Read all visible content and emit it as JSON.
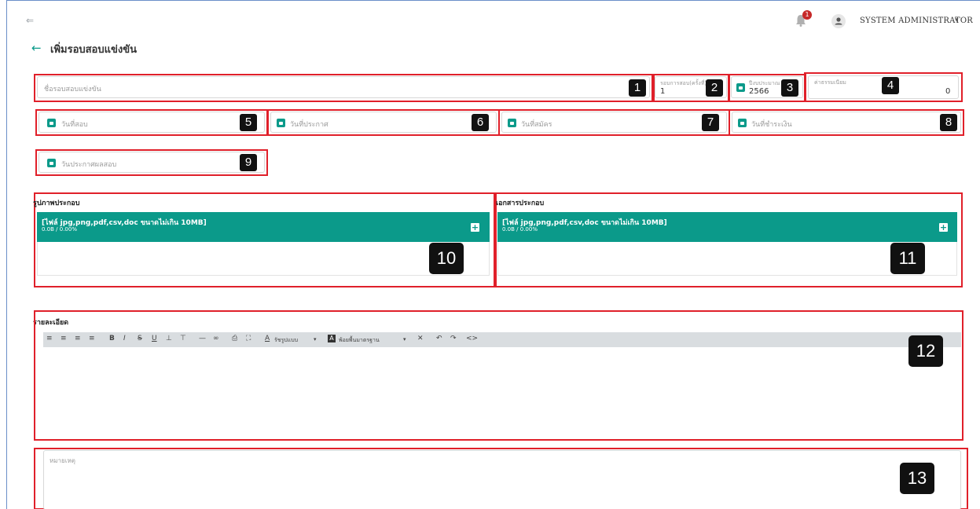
{
  "header": {
    "notification_count": "1",
    "user_name": "SYSTEM ADMINISTRATOR"
  },
  "page": {
    "title": "เพิ่มรอบสอบแข่งขัน"
  },
  "fields": {
    "round_name": {
      "placeholder": "ชื่อรอบสอบแข่งขัน",
      "marker": "1"
    },
    "round_no": {
      "label": "รอบการสอบ(ครั้งที่)",
      "value": "1",
      "marker": "2"
    },
    "fiscal_year": {
      "label": "ปีงบประมาณ",
      "value": "2566",
      "marker": "3"
    },
    "fee": {
      "label": "ค่าธรรมเนียม",
      "value": "0",
      "marker": "4"
    },
    "exam_date": {
      "placeholder": "วันที่สอบ",
      "marker": "5"
    },
    "announce_date": {
      "placeholder": "วันที่ประกาศ",
      "marker": "6"
    },
    "apply_date": {
      "placeholder": "วันที่สมัคร",
      "marker": "7"
    },
    "payment_date": {
      "placeholder": "วันที่ชำระเงิน",
      "marker": "8"
    },
    "result_date": {
      "placeholder": "วันประกาศผลสอบ",
      "marker": "9"
    }
  },
  "uploads": {
    "images": {
      "label": "รูปภาพประกอบ",
      "title": "[ไฟล์ jpg,png,pdf,csv,doc ขนาดไม่เกิน 10MB]",
      "progress": "0.0B / 0.00%",
      "marker": "10"
    },
    "documents": {
      "label": "เอกสารประกอบ",
      "title": "[ไฟล์ jpg,png,pdf,csv,doc ขนาดไม่เกิน 10MB]",
      "progress": "0.0B / 0.00%",
      "marker": "11"
    }
  },
  "details": {
    "label": "รายละเอียด",
    "marker": "12",
    "toolbar": {
      "align_left": "≡",
      "align_center": "≡",
      "align_right": "≡",
      "justify": "≡",
      "bold": "B",
      "italic": "I",
      "strike": "S",
      "underline": "U",
      "subscript": "⊥",
      "superscript": "⊤",
      "hr": "—",
      "link": "∞",
      "print": "⎙",
      "fullscreen": "⛶",
      "text_style": "รัชรูปแบบ",
      "bg_color": "พ้อยพื้นมาตรฐาน",
      "clear_format": "✕",
      "undo": "↶",
      "redo": "↷",
      "source": "<>"
    }
  },
  "remark": {
    "placeholder": "หมายเหตุ",
    "marker": "13"
  },
  "colors": {
    "accent": "#0b9a8a",
    "annotation": "#e0202a",
    "badge": "#c62828"
  }
}
